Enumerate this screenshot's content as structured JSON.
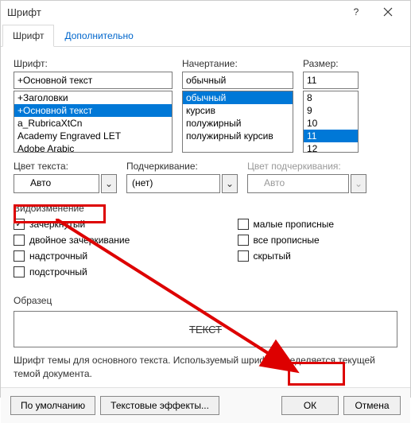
{
  "title": "Шрифт",
  "tabs": {
    "font": "Шрифт",
    "advanced": "Дополнительно"
  },
  "font": {
    "label": "Шрифт:",
    "value": "+Основной текст",
    "items": [
      "+Заголовки",
      "+Основной текст",
      "a_RubricaXtCn",
      "Academy Engraved LET",
      "Adobe Arabic"
    ]
  },
  "style": {
    "label": "Начертание:",
    "value": "обычный",
    "items": [
      "обычный",
      "курсив",
      "полужирный",
      "полужирный курсив"
    ]
  },
  "size": {
    "label": "Размер:",
    "value": "11",
    "items": [
      "8",
      "9",
      "10",
      "11",
      "12"
    ]
  },
  "color": {
    "label": "Цвет текста:",
    "value": "Авто"
  },
  "underline": {
    "label": "Подчеркивание:",
    "value": "(нет)"
  },
  "ucolor": {
    "label": "Цвет подчеркивания:",
    "value": "Авто"
  },
  "effects": {
    "label": "Видоизменение",
    "strike": "зачеркнутый",
    "dstrike": "двойное зачеркивание",
    "superscript": "надстрочный",
    "subscript": "подстрочный",
    "smallcaps": "малые прописные",
    "allcaps": "все прописные",
    "hidden": "скрытый"
  },
  "sample": {
    "label": "Образец",
    "text": "ТЕКСТ"
  },
  "hint": "Шрифт темы для основного текста. Используемый шрифт определяется текущей темой документа.",
  "buttons": {
    "default": "По умолчанию",
    "texteffects": "Текстовые эффекты...",
    "ok": "ОК",
    "cancel": "Отмена"
  },
  "chevron": "⌄"
}
